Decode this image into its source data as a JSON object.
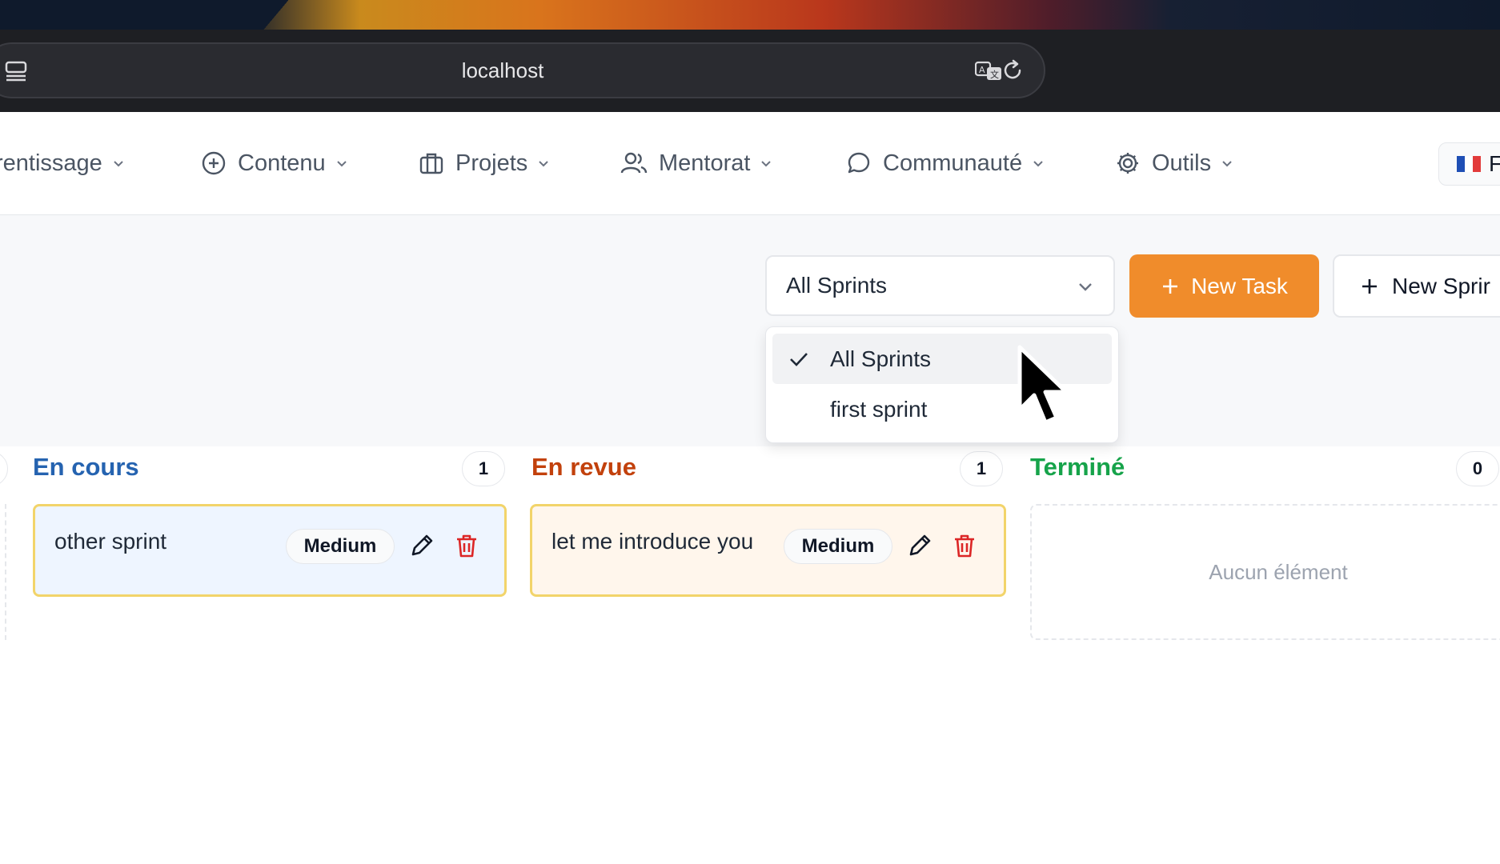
{
  "browser": {
    "url": "localhost"
  },
  "nav": {
    "items": [
      {
        "label": "rentissage",
        "icon": "none"
      },
      {
        "label": "Contenu",
        "icon": "plus-circle-icon"
      },
      {
        "label": "Projets",
        "icon": "briefcase-icon"
      },
      {
        "label": "Mentorat",
        "icon": "users-icon"
      },
      {
        "label": "Communauté",
        "icon": "chat-bubble-icon"
      },
      {
        "label": "Outils",
        "icon": "gear-icon"
      }
    ],
    "language": {
      "label": "F",
      "flag": "france-flag-icon"
    }
  },
  "toolbar": {
    "sprint_select_value": "All Sprints",
    "new_task_label": "New Task",
    "new_sprint_label": "New Sprir"
  },
  "sprint_dropdown": {
    "options": [
      {
        "label": "All Sprints",
        "selected": true
      },
      {
        "label": "first sprint",
        "selected": false
      }
    ]
  },
  "board": {
    "columns": [
      {
        "title": "En cours",
        "count": "1",
        "color": "#2563b0",
        "cards": [
          {
            "title": "other sprint",
            "priority": "Medium"
          }
        ]
      },
      {
        "title": "En revue",
        "count": "1",
        "color": "#c2410c",
        "cards": [
          {
            "title": "let me introduce you",
            "priority": "Medium"
          }
        ]
      },
      {
        "title": "Terminé",
        "count": "0",
        "color": "#16a34a",
        "empty_text": "Aucun élément"
      }
    ]
  },
  "colors": {
    "accent": "#f08c2b",
    "card_blue_bg": "#eef5ff",
    "card_orange_bg": "#fff6ec",
    "card_border": "#f2d46a",
    "danger": "#dc2626"
  }
}
